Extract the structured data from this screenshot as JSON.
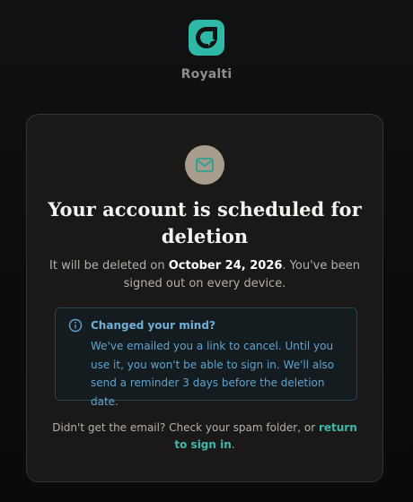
{
  "brand": {
    "logo_icon": "royalti-logo-icon",
    "name": "Royalti",
    "accent_color": "#2fb8a6"
  },
  "card": {
    "icon": "mail-icon",
    "headline": "Your account is scheduled for deletion",
    "subtext": {
      "before": "It will be deleted on ",
      "date": "October 24, 2026",
      "after": ". You've been signed out on every device."
    },
    "notice": {
      "icon": "info-icon",
      "title": "Changed your mind?",
      "body": "We've emailed you a link to cancel. Until you use it, you won't be able to sign in. We'll also send a reminder 3 days before the deletion date."
    },
    "footer": {
      "text": "Didn't get the email? Check your spam folder, or ",
      "link": "return to sign in",
      "end": "."
    }
  }
}
